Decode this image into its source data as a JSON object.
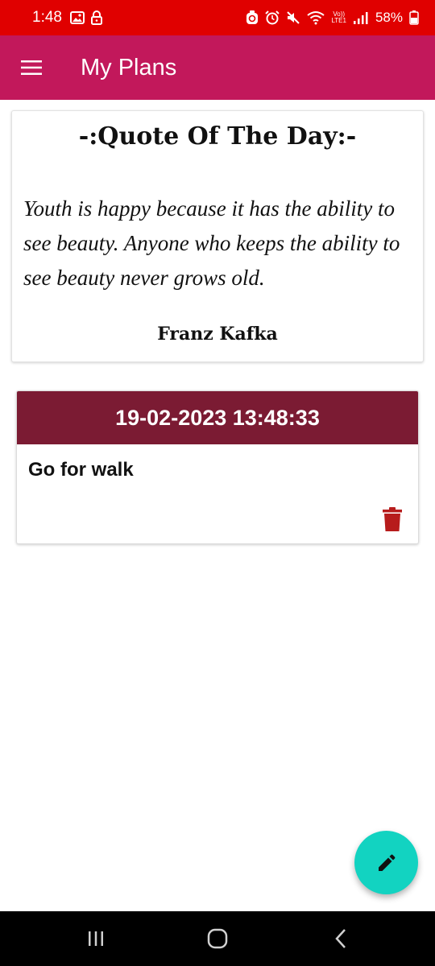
{
  "status_bar": {
    "time": "1:48",
    "battery": "58%",
    "network_top": "Vo))",
    "network_bottom": "LTE1",
    "icons": [
      "gallery-icon",
      "lock-icon",
      "sync-icon",
      "alarm-icon",
      "mute-icon",
      "wifi-icon",
      "signal-icon",
      "battery-icon"
    ]
  },
  "app_bar": {
    "title": "My Plans",
    "menu_icon": "hamburger-menu-icon",
    "background": "#c2185b"
  },
  "quote": {
    "heading": "-:Quote Of The Day:-",
    "text": "Youth is happy because it has the ability to see beauty. Anyone who keeps the ability to see beauty never grows old.",
    "author": "Franz Kafka"
  },
  "plans": [
    {
      "datetime": "19-02-2023 13:48:33",
      "text": "Go for walk",
      "delete_icon": "trash-icon"
    }
  ],
  "fab": {
    "icon": "pencil-icon",
    "color": "#12d3c1"
  },
  "nav_bar": {
    "icons": [
      "recent-apps-icon",
      "home-icon",
      "back-icon"
    ]
  },
  "colors": {
    "status_bar": "#e00000",
    "plan_header": "#7b1b33",
    "delete_icon": "#b71c1c"
  }
}
